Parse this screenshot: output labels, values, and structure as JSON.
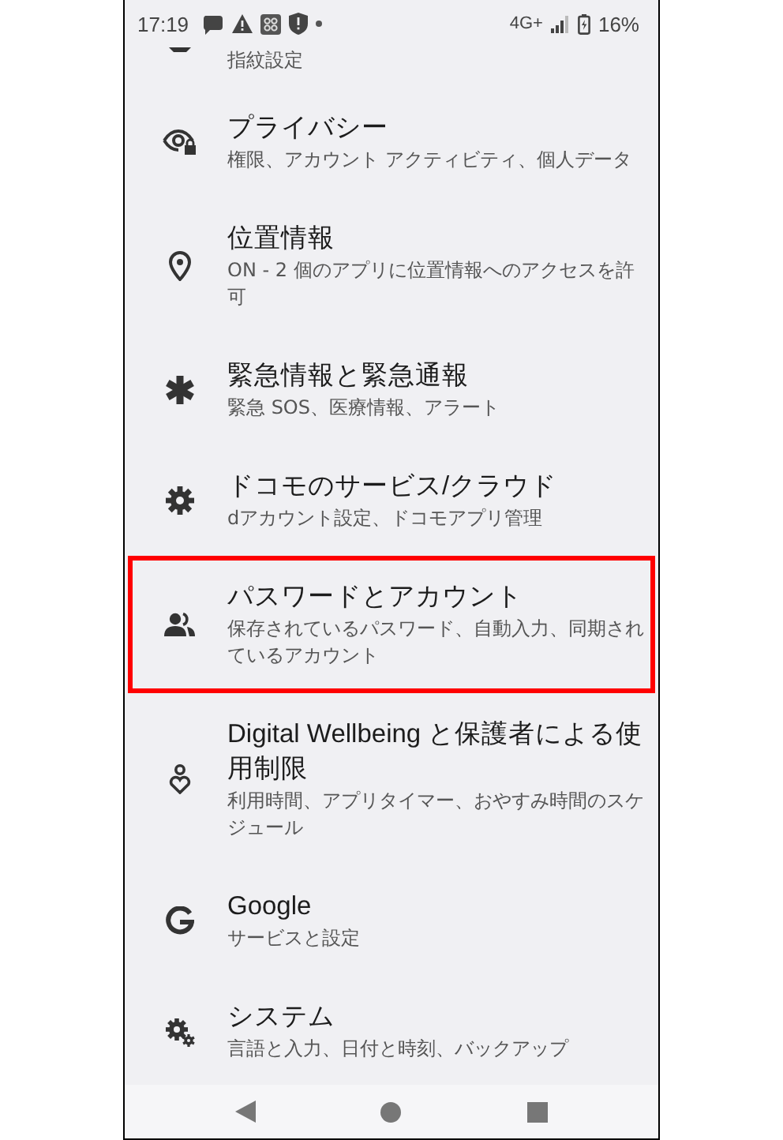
{
  "status_bar": {
    "time": "17:19",
    "network": "4G+",
    "battery": "16%"
  },
  "partial_item": {
    "subtitle": "指紋設定"
  },
  "items": [
    {
      "kind": "privacy",
      "title": "プライバシー",
      "subtitle": "権限、アカウント アクティビティ、個人データ",
      "highlighted": false
    },
    {
      "kind": "location",
      "title": "位置情報",
      "subtitle": "ON - 2 個のアプリに位置情報へのアクセスを許可",
      "highlighted": false
    },
    {
      "kind": "emergency",
      "title": "緊急情報と緊急通報",
      "subtitle": "緊急 SOS、医療情報、アラート",
      "highlighted": false
    },
    {
      "kind": "gear",
      "title": "ドコモのサービス/クラウド",
      "subtitle": "dアカウント設定、ドコモアプリ管理",
      "highlighted": false
    },
    {
      "kind": "accounts",
      "title": "パスワードとアカウント",
      "subtitle": "保存されているパスワード、自動入力、同期されているアカウント",
      "highlighted": true
    },
    {
      "kind": "wellbeing",
      "title": "Digital Wellbeing と保護者による使用制限",
      "subtitle": "利用時間、アプリタイマー、おやすみ時間のスケジュール",
      "highlighted": false
    },
    {
      "kind": "google",
      "title": "Google",
      "subtitle": "サービスと設定",
      "highlighted": false
    },
    {
      "kind": "system",
      "title": "システム",
      "subtitle": "言語と入力、日付と時刻、バックアップ",
      "highlighted": false
    }
  ]
}
